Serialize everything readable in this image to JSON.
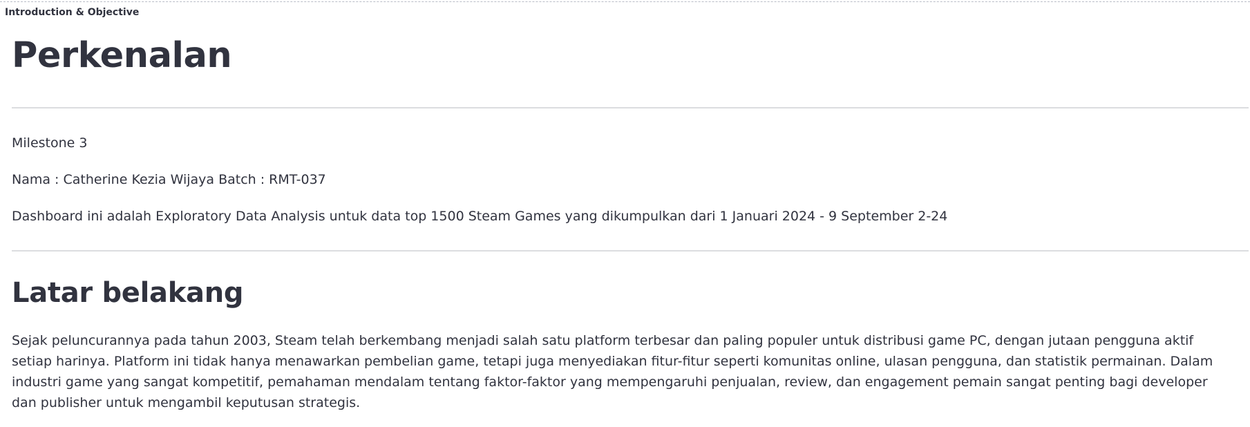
{
  "section": {
    "label": "Introduction & Objective"
  },
  "intro": {
    "title": "Perkenalan",
    "milestone": "Milestone 3",
    "name_line": "Nama : Catherine Kezia Wijaya Batch : RMT-037",
    "description": "Dashboard ini adalah Exploratory Data Analysis untuk data top 1500 Steam Games yang dikumpulkan dari 1 Januari 2024 - 9 September 2-24"
  },
  "background": {
    "title": "Latar belakang",
    "paragraph": "Sejak peluncurannya pada tahun 2003, Steam telah berkembang menjadi salah satu platform terbesar dan paling populer untuk distribusi game PC, dengan jutaan pengguna aktif setiap harinya. Platform ini tidak hanya menawarkan pembelian game, tetapi juga menyediakan fitur-fitur seperti komunitas online, ulasan pengguna, dan statistik permainan. Dalam industri game yang sangat kompetitif, pemahaman mendalam tentang faktor-faktor yang mempengaruhi penjualan, review, dan engagement pemain sangat penting bagi developer dan publisher untuk mengambil keputusan strategis."
  }
}
